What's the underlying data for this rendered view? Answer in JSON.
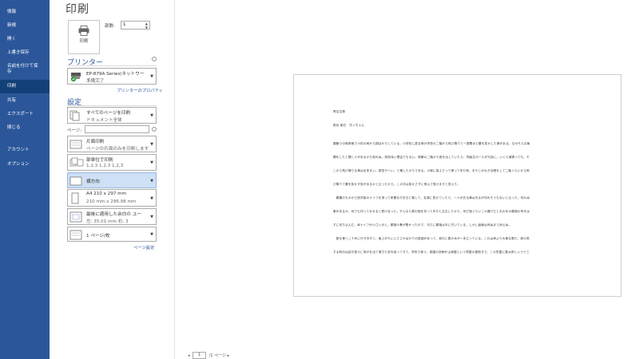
{
  "nav": {
    "items": [
      {
        "label": "情報"
      },
      {
        "label": "新規"
      },
      {
        "label": "開く"
      },
      {
        "label": "上書き保存"
      },
      {
        "label": "名前を付けて保存"
      },
      {
        "label": "印刷"
      },
      {
        "label": "共有"
      },
      {
        "label": "エクスポート"
      },
      {
        "label": "閉じる"
      },
      {
        "label": "アカウント"
      },
      {
        "label": "オプション"
      }
    ]
  },
  "page_title": "印刷",
  "print_button_label": "印刷",
  "copies": {
    "label": "部数:",
    "value": "1"
  },
  "printer": {
    "section_title": "プリンター",
    "name": "EP-879A Series(ネットワー",
    "status": "準備完了",
    "properties_link": "プリンターのプロパティ"
  },
  "settings": {
    "section_title": "設定",
    "pages_label": "ページ:",
    "page_setup_link": "ページ設定",
    "items": [
      {
        "main": "すべてのページを印刷",
        "sub": "ドキュメント全体"
      },
      {
        "main": "片面印刷",
        "sub": "ページの片面のみを印刷します"
      },
      {
        "main": "部単位で印刷",
        "sub": "1,2,3    1,2,3    1,2,3"
      },
      {
        "main": "横方向",
        "sub": ""
      },
      {
        "main": "A4 210 x 297 mm",
        "sub": "210 mm x 296.98 mm"
      },
      {
        "main": "最後に適用した余白の ユー",
        "sub": "左:  35.01 mm    右:  3"
      },
      {
        "main": "1 ページ/枚",
        "sub": ""
      }
    ]
  },
  "preview": {
    "lines": [
      "青空文庫",
      "夏目 漱石　坊っちゃん",
      "親譲りの無鉄砲で小供の時から損ばかりしている。小学校に居る時分学校の二階から飛び降りて一週間ほど腰を抜かした事がある。なぜそんな無",
      "闇をしたと聞く人があるかも知れぬ。別段深い理由でもない。新築の二階から首を出していたら、同級生の一人が冗談に、いくら威張っても、そ",
      "こから飛び降りる事は出来まい。弱虫やーい。と囃したからである。小使に負ぶさって帰って来た時、おやじが大きな眼をして二階ぐらいから飛",
      "び降りて腰を抜かす奴があるかと云ったから、この次は抜かさずに飛んで見せますと答えた。",
      "　親類のものから西洋製のナイフを貰って奇麗な刃を日に翳して、友達に見せていたら、一人が光る事は光るが切れそうもないと云った。切れぬ",
      "事があるか、何でも切ってみせると受け合った。そんなら君の指を切ってみろと注文したから、何だ指ぐらいこの通りだと右の手の親指の甲をは",
      "すに切り込んだ。幸ナイフが小さいのと、親指の骨が堅かったので、今だに親指は手に付いている。しかし創痕は死ぬまで消えぬ。",
      "　庭を東へ二十歩に行き尽すと、南上がりにいささかばかりの菜園があって、真中に栗の木が一本立っている。これは命より大事な栗だ。実の熟",
      "する時分は起き抜けに背戸を出て落ちた奴を拾ってきて、学校で食う。菜園の西側が山城屋という質屋の庭続きで、この質屋に勘太郎という十三"
    ]
  },
  "page_nav": {
    "current": "1",
    "suffix": "/1 ページ",
    "prev": "◂",
    "next": "▸"
  }
}
